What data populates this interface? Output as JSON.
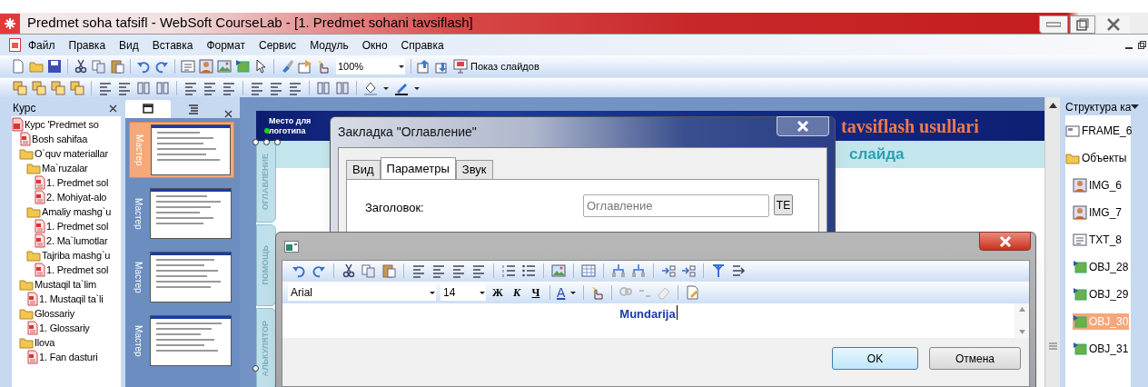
{
  "window": {
    "title": "Predmet soha tafsifl - WebSoft CourseLab - [1. Predmet sohani tavsiflash]"
  },
  "menu": [
    "Файл",
    "Правка",
    "Вид",
    "Вставка",
    "Формат",
    "Сервис",
    "Модуль",
    "Окно",
    "Справка"
  ],
  "toolbar": {
    "zoom": "100%",
    "slideshow": "Показ слайдов"
  },
  "course_panel": {
    "title": "Курс",
    "tree": [
      {
        "label": "Курс 'Predmet so",
        "kind": "course",
        "children": [
          {
            "label": "Bosh sahifaa",
            "kind": "page"
          },
          {
            "label": "O`quv materiallar",
            "kind": "folder",
            "children": [
              {
                "label": "Ma`ruzalar",
                "kind": "folder",
                "children": [
                  {
                    "label": "1. Predmet sol",
                    "kind": "page"
                  },
                  {
                    "label": "2. Mohiyat-alo",
                    "kind": "page"
                  }
                ]
              },
              {
                "label": "Amaliy mashg`u",
                "kind": "folder",
                "children": [
                  {
                    "label": "1. Predmet sol",
                    "kind": "page"
                  },
                  {
                    "label": "2. Ma`lumotlar",
                    "kind": "page"
                  }
                ]
              },
              {
                "label": "Tajriba mashg`u",
                "kind": "folder",
                "children": [
                  {
                    "label": "1. Predmet sol",
                    "kind": "page"
                  }
                ]
              }
            ]
          },
          {
            "label": "Mustaqil ta`lim",
            "kind": "folder",
            "children": [
              {
                "label": "1. Mustaqil ta`li",
                "kind": "page"
              }
            ]
          },
          {
            "label": "Glossariy",
            "kind": "folder",
            "children": [
              {
                "label": "1. Glossariy",
                "kind": "page"
              }
            ]
          },
          {
            "label": "Ilova",
            "kind": "folder",
            "children": [
              {
                "label": "1. Fan dasturi",
                "kind": "page"
              }
            ]
          }
        ]
      }
    ]
  },
  "slides_panel": {
    "tabs": [
      {
        "kind": "slides",
        "selected": true
      },
      {
        "kind": "outline",
        "selected": false
      }
    ],
    "slides": [
      {
        "label": "Мастер",
        "selected": true
      },
      {
        "label": "Мастер",
        "selected": false
      },
      {
        "label": "Мастер",
        "selected": false
      },
      {
        "label": "Мастер",
        "selected": false
      }
    ]
  },
  "slide": {
    "logo": "Место для логотипа",
    "title": "tavsiflash usullari",
    "subtitle": "слайда",
    "side_tabs": [
      "ОГЛАВЛЕНИЕ",
      "ПОМОЩЬ",
      "АЛЬКУЛЯТОР"
    ]
  },
  "structure_panel": {
    "title": "Структура ка",
    "items": [
      {
        "label": "FRAME_6",
        "kind": "frame",
        "selected": false
      },
      {
        "label": "Объекты",
        "kind": "folder",
        "selected": false
      },
      {
        "label": "IMG_6",
        "kind": "image",
        "selected": false
      },
      {
        "label": "IMG_7",
        "kind": "image",
        "selected": false
      },
      {
        "label": "TXT_8",
        "kind": "text",
        "selected": false
      },
      {
        "label": "OBJ_28",
        "kind": "object",
        "selected": false
      },
      {
        "label": "OBJ_29",
        "kind": "object",
        "selected": false
      },
      {
        "label": "OBJ_30",
        "kind": "object",
        "selected": true
      },
      {
        "label": "OBJ_31",
        "kind": "object",
        "selected": false
      }
    ]
  },
  "tab_dialog": {
    "title": "Закладка \"Оглавление\"",
    "tabs": [
      {
        "label": "Вид",
        "selected": false
      },
      {
        "label": "Параметры",
        "selected": true
      },
      {
        "label": "Звук",
        "selected": false
      }
    ],
    "field": {
      "label": "Заголовок:",
      "value": "Оглавление"
    },
    "button": "TE"
  },
  "text_dialog": {
    "font": "Arial",
    "size": "14",
    "format_buttons": [
      "Ж",
      "К",
      "Ч"
    ],
    "color_button": "A",
    "content": "Mundarija",
    "buttons": [
      "OK",
      "Отмена"
    ]
  }
}
